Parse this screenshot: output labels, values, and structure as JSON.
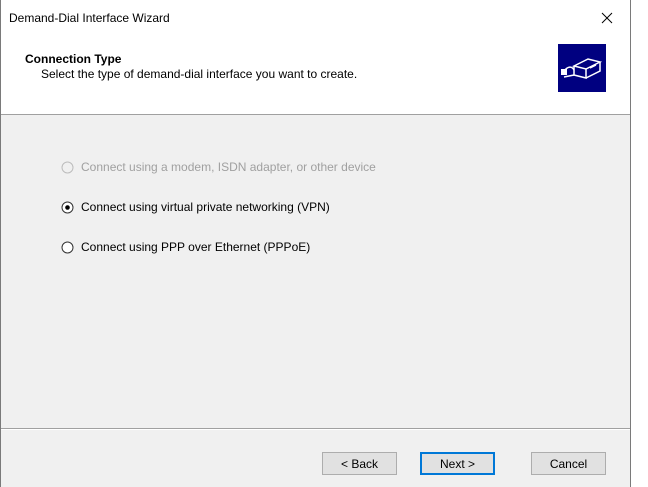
{
  "window": {
    "title": "Demand-Dial Interface Wizard"
  },
  "header": {
    "title": "Connection Type",
    "subtitle": "Select the type of demand-dial interface you want to create.",
    "icon": "network-connection-icon"
  },
  "options": [
    {
      "label": "Connect using a modem, ISDN adapter, or other device",
      "selected": false,
      "enabled": false
    },
    {
      "label": "Connect using virtual private networking (VPN)",
      "selected": true,
      "enabled": true
    },
    {
      "label": "Connect using PPP over Ethernet (PPPoE)",
      "selected": false,
      "enabled": true
    }
  ],
  "buttons": {
    "back": "< Back",
    "next": "Next >",
    "cancel": "Cancel"
  },
  "colors": {
    "window_bg": "#f0f0f0",
    "accent": "#0078d7",
    "disabled_text": "#a0a0a0",
    "icon_bg": "#000080"
  }
}
